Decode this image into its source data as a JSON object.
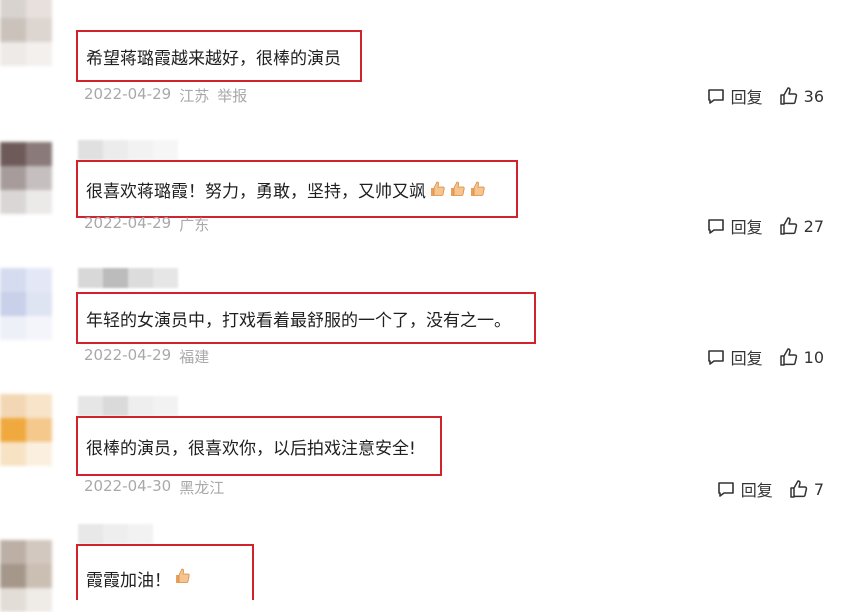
{
  "comments": [
    {
      "text": "希望蒋璐霞越来越好，很棒的演员",
      "date": "2022-04-29",
      "location": "江苏",
      "report": "举报",
      "reply_label": "回复",
      "likes": "36",
      "emoji_count": 0,
      "avatar_colors": [
        "#d9d3d0",
        "#e7e0dc",
        "#cbc2bb",
        "#ddd5cf",
        "#eeeae7",
        "#f3f0ee"
      ],
      "username_colors": []
    },
    {
      "text": "很喜欢蒋璐霞！努力，勇敢，坚持，又帅又飒",
      "date": "2022-04-29",
      "location": "广东",
      "report": "",
      "reply_label": "回复",
      "likes": "27",
      "emoji_count": 3,
      "avatar_colors": [
        "#6f5a5a",
        "#8a7b7a",
        "#a79c9b",
        "#c6bfbf",
        "#dad6d6",
        "#ece9e9"
      ],
      "username_colors": [
        "#e0e0e0",
        "#ececec",
        "#f2f2f2",
        "#f6f6f6"
      ]
    },
    {
      "text": "年轻的女演员中，打戏看着最舒服的一个了，没有之一。",
      "date": "2022-04-29",
      "location": "福建",
      "report": "",
      "reply_label": "回复",
      "likes": "10",
      "emoji_count": 0,
      "avatar_colors": [
        "#d6dcef",
        "#e4e8f6",
        "#c8d0ea",
        "#dfe4f3",
        "#eef0f8",
        "#f4f5fb"
      ],
      "username_colors": [
        "#d8d8d8",
        "#bcbcbc",
        "#dcdcdc",
        "#e6e6e6"
      ]
    },
    {
      "text": "很棒的演员，很喜欢你，以后拍戏注意安全!",
      "date": "2022-04-30",
      "location": "黑龙江",
      "report": "",
      "reply_label": "回复",
      "likes": "7",
      "emoji_count": 0,
      "avatar_colors": [
        "#f3d7b4",
        "#f7e4c9",
        "#f0a93e",
        "#f5c88c",
        "#f7e3c4",
        "#fbf0df"
      ],
      "username_colors": [
        "#e6e6e6",
        "#dadada",
        "#eeeeee",
        "#f2f2f2"
      ]
    },
    {
      "text": "霞霞加油！",
      "date": "",
      "location": "",
      "report": "",
      "reply_label": "",
      "likes": "",
      "emoji_count": 1,
      "avatar_colors": [
        "#bcb0a6",
        "#d2c8bf",
        "#a59789",
        "#cbbfb4",
        "#e3ddd7",
        "#efebe7"
      ],
      "username_colors": [
        "#e8e8e8",
        "#eeeeee",
        "#f2f2f2"
      ]
    }
  ],
  "icons": {
    "reply": "comment-bubble-icon",
    "like": "thumbs-up-icon",
    "emoji": "thumbs-up-emoji"
  },
  "colors": {
    "highlight_border": "#d0232c",
    "meta_text": "#a9a9a9"
  }
}
